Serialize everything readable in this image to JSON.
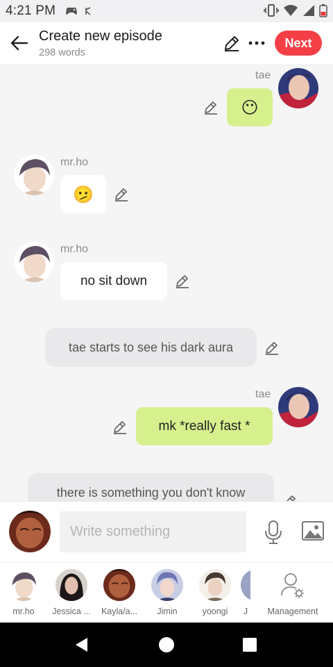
{
  "status_bar": {
    "time": "4:21 PM"
  },
  "header": {
    "title": "Create new episode",
    "word_count": "298 words",
    "next_label": "Next"
  },
  "messages": [
    {
      "speaker": "tae",
      "text": "😶",
      "side": "right",
      "kind": "dialogue"
    },
    {
      "speaker": "mr.ho",
      "text": "🫤",
      "side": "left",
      "kind": "dialogue"
    },
    {
      "speaker": "mr.ho",
      "text": "no sit down",
      "side": "left",
      "kind": "dialogue"
    },
    {
      "speaker": "",
      "text": "tae starts to see his dark aura",
      "side": "center",
      "kind": "narration"
    },
    {
      "speaker": "tae",
      "text": "mk  *really fast *",
      "side": "right",
      "kind": "dialogue"
    },
    {
      "speaker": "",
      "text": "there is something you don't know",
      "side": "center",
      "kind": "narration"
    }
  ],
  "composer": {
    "placeholder": "Write something"
  },
  "characters": [
    {
      "name": "mr.ho",
      "color": "#6b5a6e"
    },
    {
      "name": "Jessica ...",
      "color": "#2d2426"
    },
    {
      "name": "Kayla/a...",
      "color": "#8a3b2b"
    },
    {
      "name": "Jimin",
      "color": "#7d84b8"
    },
    {
      "name": "yoongi",
      "color": "#5a4a3e"
    },
    {
      "name": "J",
      "color": "#9aa3c4"
    }
  ],
  "management_label": "Management",
  "colors": {
    "accent": "#f43f46",
    "bubble_green": "#d7f08e"
  }
}
